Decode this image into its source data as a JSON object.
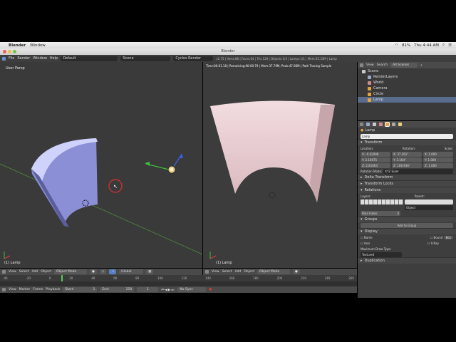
{
  "macbar": {
    "app": "Blender",
    "menu_window": "Window",
    "battery": "81%",
    "clock": "Thu 4:44 AM"
  },
  "window_title": "Blender",
  "info": {
    "menus": [
      "File",
      "Render",
      "Window",
      "Help"
    ],
    "layout": "Default",
    "scene": "Scene",
    "engine": "Cycles Render",
    "stats": "v2.75 | Verts:88 | Faces:64 | Tris:128 | Objects:1/3 | Lamps:1/1 | Mem:55.33M | Lamp"
  },
  "viewport": {
    "label": "User Persp",
    "object_label": "(1) Lamp",
    "header": [
      "View",
      "Select",
      "Add",
      "Object"
    ],
    "mode": "Object Mode",
    "orientation": "Global"
  },
  "render": {
    "status": "Time:00:01.18 | Remaining:00:00.79 | Mem:37.79M, Peak:47.66M | Path Tracing Sample",
    "object_label": "(1) Lamp",
    "header": [
      "View",
      "Select",
      "Add",
      "Object"
    ],
    "mode": "Object Mode"
  },
  "timeline": {
    "header": [
      "View",
      "Marker",
      "Frame",
      "Playback"
    ],
    "start_label": "Start:",
    "start": "1",
    "end_label": "End:",
    "end": "250",
    "current": "1",
    "sync": "No Sync",
    "ticks": [
      "-40",
      "-20",
      "0",
      "20",
      "40",
      "60",
      "80",
      "100",
      "120",
      "140",
      "160",
      "180",
      "200",
      "220",
      "240",
      "260"
    ]
  },
  "outliner": {
    "menus": [
      "View",
      "Search"
    ],
    "filter": "All Scenes",
    "items": [
      {
        "label": "Scene",
        "depth": 0,
        "color": "#c9c9c9"
      },
      {
        "label": "RenderLayers",
        "depth": 1,
        "color": "#9aa9c7"
      },
      {
        "label": "World",
        "depth": 1,
        "color": "#d08a8a"
      },
      {
        "label": "Camera",
        "depth": 1,
        "color": "#e6a23c"
      },
      {
        "label": "Circle",
        "depth": 1,
        "color": "#e6a23c"
      },
      {
        "label": "Lamp",
        "depth": 1,
        "color": "#e6a23c"
      }
    ]
  },
  "props": {
    "breadcrumb": "Lamp",
    "name": "Lamp",
    "transform": {
      "title": "Transform",
      "location_label": "Location:",
      "rotation_label": "Rotation:",
      "scale_label": "Scale:",
      "location": [
        "X: -0.02098",
        "Y: 2.16675",
        "Z: 2.81063"
      ],
      "rotation": [
        "X: 37.261°",
        "Y: 3.164°",
        "Z: 106.936°"
      ],
      "scale": [
        "X: 1.000",
        "Y: 1.000",
        "Z: 1.000"
      ],
      "mode_label": "Rotation Mode:",
      "mode": "XYZ Euler"
    },
    "sections": [
      "Delta Transform",
      "Transform Locks",
      "Relations"
    ],
    "relations": {
      "layers_label": "Layers:",
      "parent_label": "Parent:",
      "parent_type": "Object",
      "pass_index": "Pass Index:",
      "pass_value": "0"
    },
    "groups": {
      "title": "Groups",
      "add": "Add to Group"
    },
    "display": {
      "title": "Display",
      "options": [
        "Name",
        "Axis",
        "Bound",
        "X-Ray"
      ],
      "bound_type": "Box",
      "max_label": "Maximum Draw Type:",
      "max": "Textured"
    },
    "duplication": "Duplication"
  }
}
